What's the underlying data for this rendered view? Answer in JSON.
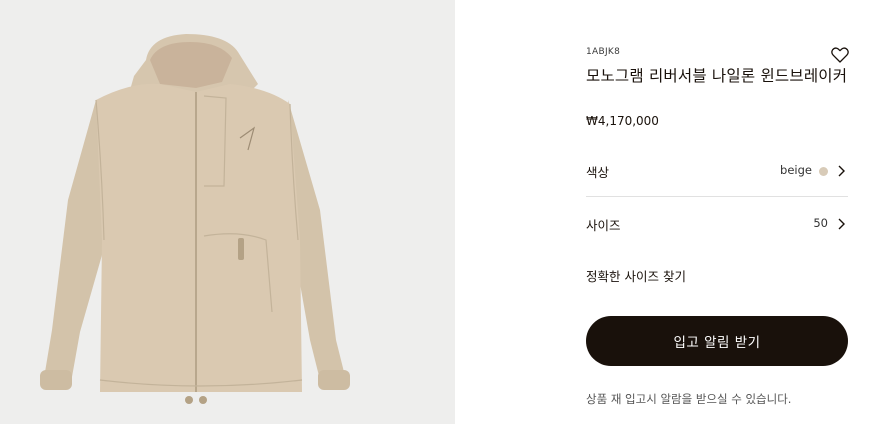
{
  "gallery": {
    "image_alt": "beige nylon windbreaker jacket with hood",
    "colors": {
      "background": "#eeeeed",
      "jacket": "#d8c9b2",
      "jacket_shadow": "#c3b39a",
      "lining": "#c9b39b"
    }
  },
  "product": {
    "sku": "1ABJK8",
    "title": "모노그램 리버서블 나일론 윈드브레이커",
    "price": "₩4,170,000",
    "wishlist_icon": "heart-outline-icon"
  },
  "options": {
    "color": {
      "label": "색상",
      "value": "beige",
      "swatch": "#d8cbb8"
    },
    "size": {
      "label": "사이즈",
      "value": "50"
    }
  },
  "size_guide": {
    "label": "정확한 사이즈 찾기"
  },
  "cta": {
    "label": "입고 알림 받기",
    "background": "#19110b",
    "text_color": "#ffffff"
  },
  "notice": "상품 재 입고시 알람을 받으실 수 있습니다."
}
